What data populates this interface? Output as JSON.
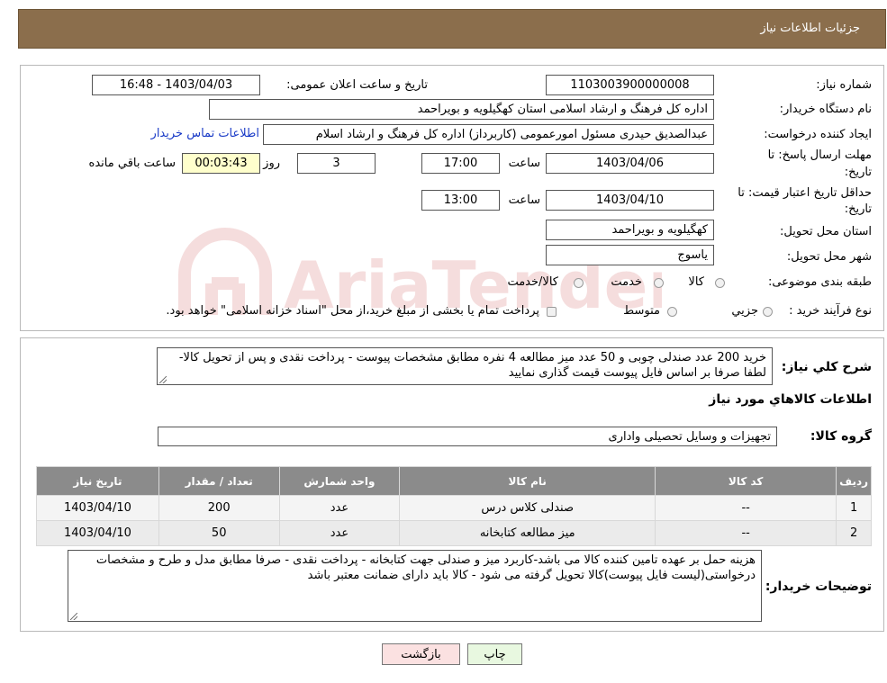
{
  "header": {
    "title": "جزئیات اطلاعات نیاز"
  },
  "info": {
    "need_number_label": "شماره نیاز:",
    "need_number": "1103003900000008",
    "announce_label": "تاریخ و ساعت اعلان عمومی:",
    "announce_value": "1403/04/03 - 16:48",
    "buyer_org_label": "نام دستگاه خریدار:",
    "buyer_org": "اداره کل فرهنگ و ارشاد اسلامی استان کهگیلویه و بویراحمد",
    "requester_label": "ایجاد کننده درخواست:",
    "requester": "عبدالصدیق حیدری مسئول امورعمومی (کاربرداز) اداره کل فرهنگ و ارشاد اسلام",
    "contact_link": "اطلاعات تماس خریدار",
    "deadline_label_1": "مهلت ارسال پاسخ: تا",
    "deadline_label_2": "تاریخ:",
    "deadline_date": "1403/04/06",
    "time_label": "ساعت",
    "deadline_time": "17:00",
    "days": "3",
    "days_label": "روز و",
    "remaining": "00:03:43",
    "remaining_label": "ساعت باقي مانده",
    "validity_label_1": "حداقل تاریخ اعتبار قیمت: تا",
    "validity_label_2": "تاریخ:",
    "validity_date": "1403/04/10",
    "validity_time": "13:00",
    "province_label": "استان محل تحویل:",
    "province": "کهگیلویه و بویراحمد",
    "city_label": "شهر محل تحویل:",
    "city": "یاسوج",
    "category_label": "طبقه بندی موضوعی:",
    "category_options": [
      "کالا",
      "خدمت",
      "کالا/خدمت"
    ],
    "process_label": "نوع فرآیند خرید :",
    "process_options": [
      "جزیي",
      "متوسط"
    ],
    "process_note": "پرداخت تمام یا بخشی از مبلغ خرید،از محل \"اسناد خزانه اسلامی\" خواهد بود."
  },
  "details": {
    "description_label": "شرح کلي نياز:",
    "description": "خرید 200 عدد صندلی چوبی و 50 عدد میز مطالعه 4 نفره مطابق مشخصات پیوست - پرداخت نقدی و پس از تحویل کالا-لطفا صرفا بر اساس فایل پیوست قیمت گذاری نمایید",
    "goods_info_title": "اطلاعات کالاهاي مورد نياز",
    "goods_group_label": "گروه کالا:",
    "goods_group": "تجهیزات و وسایل تحصیلی واداری",
    "table_headers": [
      "رديف",
      "کد کالا",
      "نام کالا",
      "واحد شمارش",
      "تعداد / مقدار",
      "تاریخ نیاز"
    ],
    "rows": [
      [
        "1",
        "--",
        "صندلی کلاس درس",
        "عدد",
        "200",
        "1403/04/10"
      ],
      [
        "2",
        "--",
        "میز مطالعه کتابخانه",
        "عدد",
        "50",
        "1403/04/10"
      ]
    ],
    "buyer_notes_label": "توضیحات خریدار:",
    "buyer_notes": "هزینه حمل بر عهده تامین کننده کالا می باشد-کاربرد میز و صندلی جهت کتابخانه - پرداخت نقدی - صرفا مطابق مدل و طرح و مشخصات درخواستی(لیست فایل پیوست)کالا تحویل گرفته می شود - کالا باید دارای ضمانت معتبر باشد"
  },
  "buttons": {
    "print": "چاپ",
    "back": "بازگشت"
  },
  "watermark": {
    "text": "AriaTender.neT"
  },
  "colors": {
    "header_bg": "#8b6e4c",
    "table_header_bg": "#8b8b8b",
    "print_bg": "#e8f8e0",
    "back_bg": "#fbe1e1",
    "watermark": "#c94a4a"
  }
}
